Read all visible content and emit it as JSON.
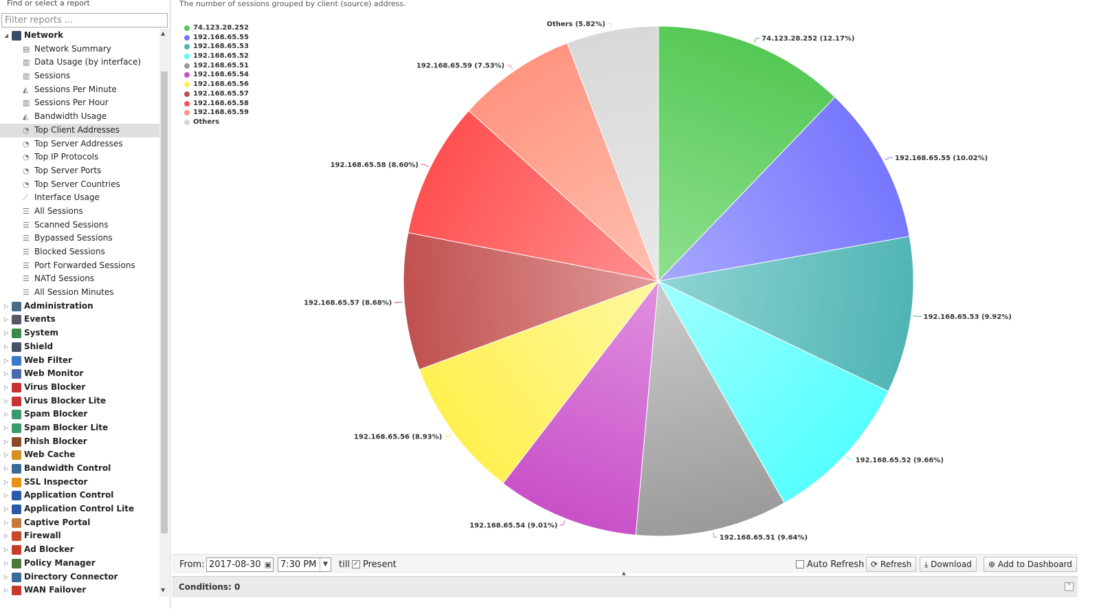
{
  "sidebar": {
    "title": "Find or select a report",
    "filter_placeholder": "Filter reports ...",
    "tree": [
      {
        "label": "Network",
        "level": 0,
        "expanded": true,
        "icon": "network-icon",
        "color": "#3b4b6b"
      },
      {
        "label": "Network Summary",
        "level": 1,
        "icon": "table-icon"
      },
      {
        "label": "Data Usage (by interface)",
        "level": 1,
        "icon": "bar-chart-icon"
      },
      {
        "label": "Sessions",
        "level": 1,
        "icon": "bar-chart-icon"
      },
      {
        "label": "Sessions Per Minute",
        "level": 1,
        "icon": "area-chart-icon"
      },
      {
        "label": "Sessions Per Hour",
        "level": 1,
        "icon": "bar-chart-icon"
      },
      {
        "label": "Bandwidth Usage",
        "level": 1,
        "icon": "area-chart-icon"
      },
      {
        "label": "Top Client Addresses",
        "level": 1,
        "icon": "pie-chart-icon",
        "selected": true
      },
      {
        "label": "Top Server Addresses",
        "level": 1,
        "icon": "pie-chart-icon"
      },
      {
        "label": "Top IP Protocols",
        "level": 1,
        "icon": "pie-chart-icon"
      },
      {
        "label": "Top Server Ports",
        "level": 1,
        "icon": "pie-chart-icon"
      },
      {
        "label": "Top Server Countries",
        "level": 1,
        "icon": "pie-chart-icon"
      },
      {
        "label": "Interface Usage",
        "level": 1,
        "icon": "line-chart-icon"
      },
      {
        "label": "All Sessions",
        "level": 1,
        "icon": "list-icon"
      },
      {
        "label": "Scanned Sessions",
        "level": 1,
        "icon": "list-icon"
      },
      {
        "label": "Bypassed Sessions",
        "level": 1,
        "icon": "list-icon"
      },
      {
        "label": "Blocked Sessions",
        "level": 1,
        "icon": "list-icon"
      },
      {
        "label": "Port Forwarded Sessions",
        "level": 1,
        "icon": "list-icon"
      },
      {
        "label": "NATd Sessions",
        "level": 1,
        "icon": "list-icon"
      },
      {
        "label": "All Session Minutes",
        "level": 1,
        "icon": "list-icon"
      },
      {
        "label": "Administration",
        "level": 0,
        "icon": "administration-icon",
        "color": "#4a6a8a"
      },
      {
        "label": "Events",
        "level": 0,
        "icon": "events-icon",
        "color": "#555a66"
      },
      {
        "label": "System",
        "level": 0,
        "icon": "system-icon",
        "color": "#3a8a4a"
      },
      {
        "label": "Shield",
        "level": 0,
        "icon": "shield-icon",
        "color": "#445066"
      },
      {
        "label": "Web Filter",
        "level": 0,
        "icon": "web-filter-icon",
        "color": "#3a7ac8"
      },
      {
        "label": "Web Monitor",
        "level": 0,
        "icon": "web-monitor-icon",
        "color": "#4a6ab0"
      },
      {
        "label": "Virus Blocker",
        "level": 0,
        "icon": "virus-blocker-icon",
        "color": "#c83232"
      },
      {
        "label": "Virus Blocker Lite",
        "level": 0,
        "icon": "virus-blocker-lite-icon",
        "color": "#c83232"
      },
      {
        "label": "Spam Blocker",
        "level": 0,
        "icon": "spam-blocker-icon",
        "color": "#3a9a6a"
      },
      {
        "label": "Spam Blocker Lite",
        "level": 0,
        "icon": "spam-blocker-lite-icon",
        "color": "#3a9a6a"
      },
      {
        "label": "Phish Blocker",
        "level": 0,
        "icon": "phish-blocker-icon",
        "color": "#8a4a2a"
      },
      {
        "label": "Web Cache",
        "level": 0,
        "icon": "web-cache-icon",
        "color": "#d89020"
      },
      {
        "label": "Bandwidth Control",
        "level": 0,
        "icon": "bandwidth-control-icon",
        "color": "#3a6a9a"
      },
      {
        "label": "SSL Inspector",
        "level": 0,
        "icon": "ssl-inspector-icon",
        "color": "#e8901a"
      },
      {
        "label": "Application Control",
        "level": 0,
        "icon": "application-control-icon",
        "color": "#2a5aa8"
      },
      {
        "label": "Application Control Lite",
        "level": 0,
        "icon": "application-control-lite-icon",
        "color": "#2a5aa8"
      },
      {
        "label": "Captive Portal",
        "level": 0,
        "icon": "captive-portal-icon",
        "color": "#c87a3a"
      },
      {
        "label": "Firewall",
        "level": 0,
        "icon": "firewall-icon",
        "color": "#c84a2a"
      },
      {
        "label": "Ad Blocker",
        "level": 0,
        "icon": "ad-blocker-icon",
        "color": "#c83a2a"
      },
      {
        "label": "Policy Manager",
        "level": 0,
        "icon": "policy-manager-icon",
        "color": "#4a7a3a"
      },
      {
        "label": "Directory Connector",
        "level": 0,
        "icon": "directory-connector-icon",
        "color": "#3a6a9a"
      },
      {
        "label": "WAN Failover",
        "level": 0,
        "icon": "wan-failover-icon",
        "color": "#c83a2a"
      }
    ]
  },
  "report": {
    "description": "The number of sessions grouped by client (source) address."
  },
  "chart_data": {
    "type": "pie",
    "title": "",
    "legend_position": "top-left",
    "slices": [
      {
        "label": "74.123.28.252",
        "value": 12.17,
        "display": "74.123.28.252 (12.17%)",
        "color": "#55c855",
        "light": "#90e090"
      },
      {
        "label": "192.168.65.55",
        "value": 10.02,
        "display": "192.168.65.55 (10.02%)",
        "color": "#7676ff",
        "light": "#a8a8ff"
      },
      {
        "label": "192.168.65.53",
        "value": 9.92,
        "display": "192.168.65.53 (9.92%)",
        "color": "#50b4b4",
        "light": "#90d4d4"
      },
      {
        "label": "192.168.65.52",
        "value": 9.66,
        "display": "192.168.65.52 (9.66%)",
        "color": "#55ffff",
        "light": "#a0ffff"
      },
      {
        "label": "192.168.65.51",
        "value": 9.64,
        "display": "192.168.65.51 (9.64%)",
        "color": "#9a9a9a",
        "light": "#cccccc"
      },
      {
        "label": "192.168.65.54",
        "value": 9.01,
        "display": "192.168.65.54 (9.01%)",
        "color": "#c850c8",
        "light": "#e090e0"
      },
      {
        "label": "192.168.65.56",
        "value": 8.93,
        "display": "192.168.65.56 (8.93%)",
        "color": "#fff050",
        "light": "#fff8a0"
      },
      {
        "label": "192.168.65.57",
        "value": 8.68,
        "display": "192.168.65.57 (8.68%)",
        "color": "#c05050",
        "light": "#e09a9a"
      },
      {
        "label": "192.168.65.58",
        "value": 8.6,
        "display": "192.168.65.58 (8.60%)",
        "color": "#ff5050",
        "light": "#ff9090"
      },
      {
        "label": "192.168.65.59",
        "value": 7.53,
        "display": "192.168.65.59 (7.53%)",
        "color": "#ff9480",
        "light": "#ffc0b0"
      },
      {
        "label": "Others",
        "value": 5.82,
        "display": "Others (5.82%)",
        "color": "#d8d8d8",
        "light": "#e8e8e8"
      }
    ]
  },
  "toolbar": {
    "from_label": "From:",
    "from_date": "2017-08-30",
    "from_time": "7:30 PM",
    "till_label": "till",
    "present_label": "Present",
    "present_checked": true,
    "auto_refresh_label": "Auto Refresh",
    "auto_refresh_checked": false,
    "refresh_label": "Refresh",
    "download_label": "Download",
    "add_dashboard_label": "Add to Dashboard"
  },
  "conditions": {
    "label": "Conditions: 0"
  }
}
